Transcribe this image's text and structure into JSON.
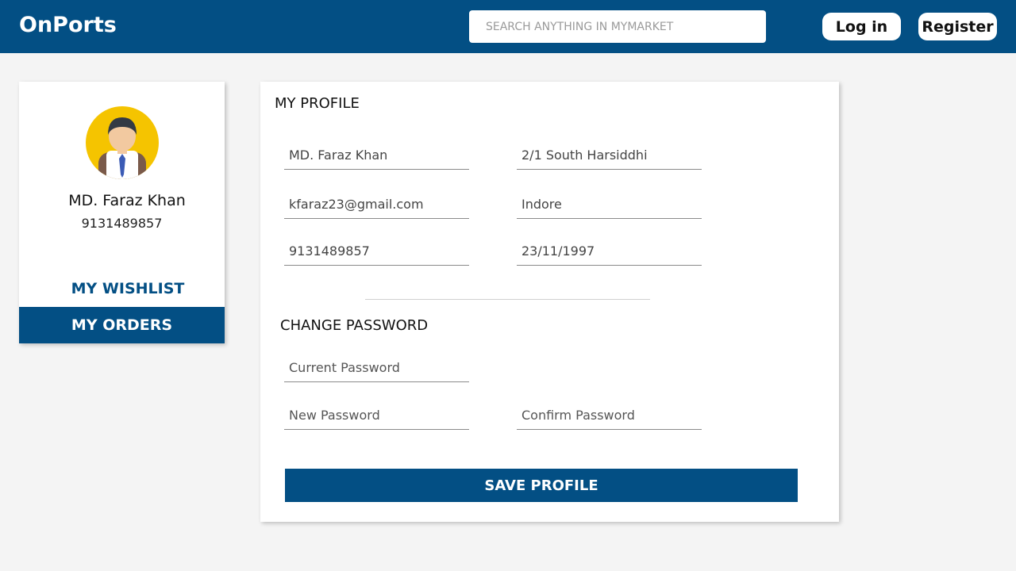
{
  "header": {
    "brand": "OnPorts",
    "search_placeholder": "SEARCH ANYTHING IN MYMARKET",
    "login_label": "Log in",
    "register_label": "Register"
  },
  "sidebar": {
    "avatar_icon": "user-avatar-icon",
    "name": "MD. Faraz Khan",
    "phone": "9131489857",
    "wishlist_label": "MY WISHLIST",
    "orders_label": "MY ORDERS"
  },
  "profile": {
    "title": "MY PROFILE",
    "name": "MD. Faraz Khan",
    "address": "2/1 South Harsiddhi",
    "email": "kfaraz23@gmail.com",
    "city": "Indore",
    "phone": "9131489857",
    "dob": "23/11/1997"
  },
  "password": {
    "title": "CHANGE PASSWORD",
    "current_placeholder": "Current Password",
    "new_placeholder": "New Password",
    "confirm_placeholder": "Confirm Password"
  },
  "save_label": "SAVE PROFILE",
  "colors": {
    "primary": "#034f84",
    "background": "#f4f4f4",
    "avatar_bg": "#f5c400"
  }
}
